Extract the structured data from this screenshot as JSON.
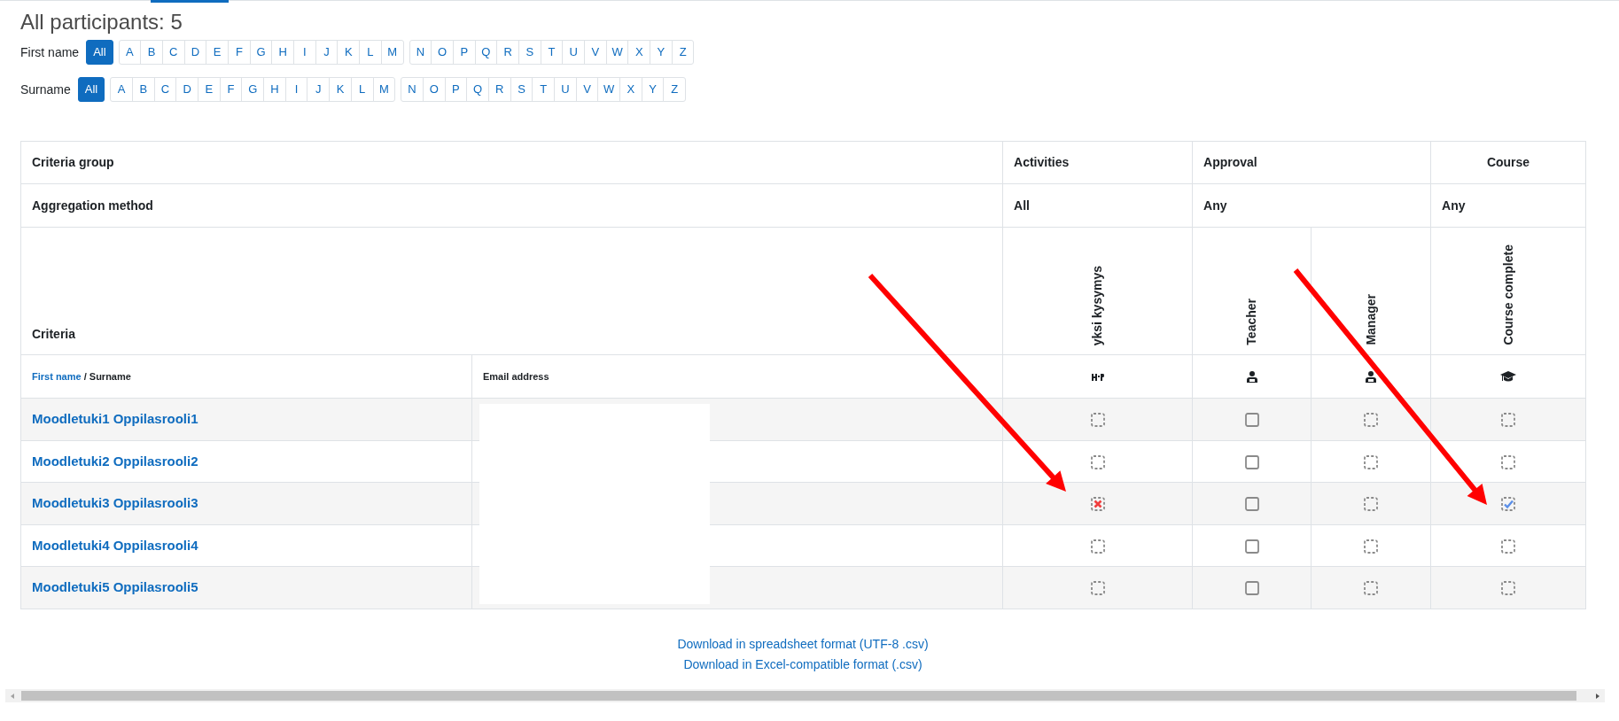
{
  "title": "All participants: 5",
  "filters": [
    {
      "label": "First name",
      "groups": [
        [
          {
            "text": "All",
            "selected": true
          }
        ],
        [
          {
            "text": "A",
            "selected": false
          },
          {
            "text": "B",
            "selected": false
          },
          {
            "text": "C",
            "selected": false
          },
          {
            "text": "D",
            "selected": false
          },
          {
            "text": "E",
            "selected": false
          },
          {
            "text": "F",
            "selected": false
          },
          {
            "text": "G",
            "selected": false
          },
          {
            "text": "H",
            "selected": false
          },
          {
            "text": "I",
            "selected": false
          },
          {
            "text": "J",
            "selected": false
          },
          {
            "text": "K",
            "selected": false
          },
          {
            "text": "L",
            "selected": false
          },
          {
            "text": "M",
            "selected": false
          }
        ],
        [
          {
            "text": "N",
            "selected": false
          },
          {
            "text": "O",
            "selected": false
          },
          {
            "text": "P",
            "selected": false
          },
          {
            "text": "Q",
            "selected": false
          },
          {
            "text": "R",
            "selected": false
          },
          {
            "text": "S",
            "selected": false
          },
          {
            "text": "T",
            "selected": false
          },
          {
            "text": "U",
            "selected": false
          },
          {
            "text": "V",
            "selected": false
          },
          {
            "text": "W",
            "selected": false
          },
          {
            "text": "X",
            "selected": false
          },
          {
            "text": "Y",
            "selected": false
          },
          {
            "text": "Z",
            "selected": false
          }
        ]
      ]
    },
    {
      "label": "Surname",
      "groups": [
        [
          {
            "text": "All",
            "selected": true
          }
        ],
        [
          {
            "text": "A",
            "selected": false
          },
          {
            "text": "B",
            "selected": false
          },
          {
            "text": "C",
            "selected": false
          },
          {
            "text": "D",
            "selected": false
          },
          {
            "text": "E",
            "selected": false
          },
          {
            "text": "F",
            "selected": false
          },
          {
            "text": "G",
            "selected": false
          },
          {
            "text": "H",
            "selected": false
          },
          {
            "text": "I",
            "selected": false
          },
          {
            "text": "J",
            "selected": false
          },
          {
            "text": "K",
            "selected": false
          },
          {
            "text": "L",
            "selected": false
          },
          {
            "text": "M",
            "selected": false
          }
        ],
        [
          {
            "text": "N",
            "selected": false
          },
          {
            "text": "O",
            "selected": false
          },
          {
            "text": "P",
            "selected": false
          },
          {
            "text": "Q",
            "selected": false
          },
          {
            "text": "R",
            "selected": false
          },
          {
            "text": "S",
            "selected": false
          },
          {
            "text": "T",
            "selected": false
          },
          {
            "text": "U",
            "selected": false
          },
          {
            "text": "V",
            "selected": false
          },
          {
            "text": "W",
            "selected": false
          },
          {
            "text": "X",
            "selected": false
          },
          {
            "text": "Y",
            "selected": false
          },
          {
            "text": "Z",
            "selected": false
          }
        ]
      ]
    }
  ],
  "table": {
    "criteria_group_label": "Criteria group",
    "aggregation_label": "Aggregation method",
    "criteria_label": "Criteria",
    "groups": [
      {
        "name": "Activities",
        "aggregation": "All",
        "criteria": [
          {
            "text": "yksi kysymys",
            "kind": "h5p"
          }
        ]
      },
      {
        "name": "Approval",
        "aggregation": "Any",
        "criteria": [
          {
            "text": "Teacher",
            "kind": "role"
          },
          {
            "text": "Manager",
            "kind": "role"
          }
        ]
      },
      {
        "name": "Course",
        "aggregation": "Any",
        "criteria": [
          {
            "text": "Course complete",
            "kind": "course"
          }
        ]
      }
    ],
    "name_heading": {
      "first": "First name",
      "separator": " / ",
      "second": "Surname"
    },
    "email_heading": "Email address",
    "rows": [
      {
        "name": "Moodletuki1 Oppilasrooli1",
        "cells": [
          {
            "kind": "auto",
            "checked": false,
            "failed": false
          },
          {
            "kind": "manual",
            "checked": false,
            "failed": false
          },
          {
            "kind": "auto",
            "checked": false,
            "failed": false
          },
          {
            "kind": "auto",
            "checked": false,
            "failed": false
          }
        ]
      },
      {
        "name": "Moodletuki2 Oppilasrooli2",
        "cells": [
          {
            "kind": "auto",
            "checked": false,
            "failed": false
          },
          {
            "kind": "manual",
            "checked": false,
            "failed": false
          },
          {
            "kind": "auto",
            "checked": false,
            "failed": false
          },
          {
            "kind": "auto",
            "checked": false,
            "failed": false
          }
        ]
      },
      {
        "name": "Moodletuki3 Oppilasrooli3",
        "cells": [
          {
            "kind": "auto",
            "checked": false,
            "failed": true
          },
          {
            "kind": "manual",
            "checked": false,
            "failed": false
          },
          {
            "kind": "auto",
            "checked": false,
            "failed": false
          },
          {
            "kind": "auto",
            "checked": true,
            "failed": false
          }
        ]
      },
      {
        "name": "Moodletuki4 Oppilasrooli4",
        "cells": [
          {
            "kind": "auto",
            "checked": false,
            "failed": false
          },
          {
            "kind": "manual",
            "checked": false,
            "failed": false
          },
          {
            "kind": "auto",
            "checked": false,
            "failed": false
          },
          {
            "kind": "auto",
            "checked": false,
            "failed": false
          }
        ]
      },
      {
        "name": "Moodletuki5 Oppilasrooli5",
        "cells": [
          {
            "kind": "auto",
            "checked": false,
            "failed": false
          },
          {
            "kind": "manual",
            "checked": false,
            "failed": false
          },
          {
            "kind": "auto",
            "checked": false,
            "failed": false
          },
          {
            "kind": "auto",
            "checked": false,
            "failed": false
          }
        ]
      }
    ]
  },
  "downloads": [
    "Download in spreadsheet format (UTF-8 .csv)",
    "Download in Excel-compatible format (.csv)"
  ]
}
